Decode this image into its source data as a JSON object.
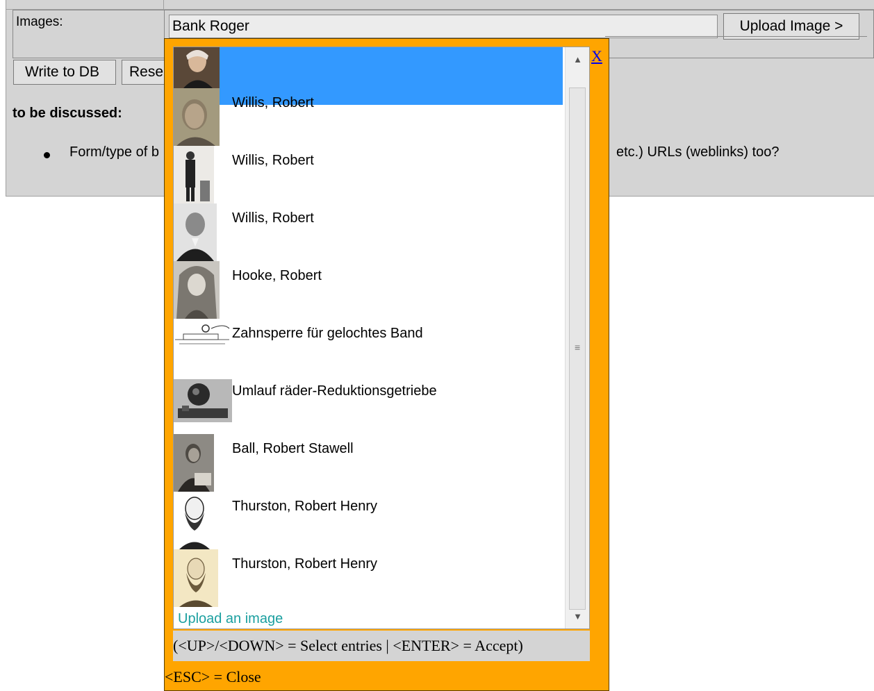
{
  "form": {
    "images_label": "Images:",
    "images_value": "Bank Roger",
    "upload_image_label": "Upload Image >",
    "write_db_label": "Write to DB",
    "reset_label": "Rese",
    "discussed_heading": "to be discussed:",
    "bullet_text_left": "Form/type of b",
    "bullet_text_right": "etc.) URLs (weblinks) too?"
  },
  "popup": {
    "close_label": "X",
    "items": [
      {
        "label": "",
        "selected": true,
        "thumbnail": "portrait-photo"
      },
      {
        "label": "Willis, Robert",
        "selected": false,
        "thumbnail": "portrait-photo"
      },
      {
        "label": "Willis, Robert",
        "selected": false,
        "thumbnail": "standing-figure-photo"
      },
      {
        "label": "Willis, Robert",
        "selected": false,
        "thumbnail": "portrait-engraving"
      },
      {
        "label": "Hooke, Robert",
        "selected": false,
        "thumbnail": "portrait-engraving"
      },
      {
        "label": "Zahnsperre für gelochtes Band",
        "selected": false,
        "thumbnail": "mechanism-drawing"
      },
      {
        "label": "Umlauf räder-Reduktionsgetriebe",
        "selected": false,
        "thumbnail": "gear-photo"
      },
      {
        "label": "Ball, Robert Stawell",
        "selected": false,
        "thumbnail": "portrait-photo"
      },
      {
        "label": "Thurston, Robert Henry",
        "selected": false,
        "thumbnail": "portrait-engraving"
      },
      {
        "label": "Thurston, Robert Henry",
        "selected": false,
        "thumbnail": "portrait-engraving"
      }
    ],
    "upload_link_label": "Upload an image",
    "hint_text": "(<UP>/<DOWN> = Select entries | <ENTER> = Accept)",
    "esc_text": "<ESC> = Close"
  },
  "colors": {
    "popup_background": "#ffa500",
    "selection": "#3399ff",
    "upload_link": "#1a9f9f",
    "panel": "#d4d4d4"
  }
}
